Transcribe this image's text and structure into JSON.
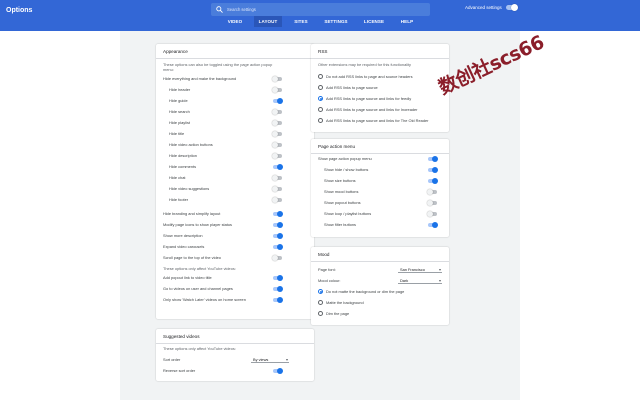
{
  "app": {
    "title": "Options"
  },
  "search": {
    "placeholder": "Search settings"
  },
  "advanced": {
    "label": "Advanced settings",
    "enabled": true
  },
  "tabs": [
    {
      "label": "VIDEO",
      "active": false
    },
    {
      "label": "LAYOUT",
      "active": true
    },
    {
      "label": "SITES",
      "active": false
    },
    {
      "label": "SETTINGS",
      "active": false
    },
    {
      "label": "LICENSE",
      "active": false
    },
    {
      "label": "HELP",
      "active": false
    }
  ],
  "appearance": {
    "title": "Appearance",
    "note": "These options can also be toggled using the page action popup menu:",
    "hide_everything": {
      "label": "Hide everything and make the background",
      "on": false
    },
    "sub_items": [
      {
        "label": "Hide header",
        "on": false
      },
      {
        "label": "Hide guide",
        "on": true
      },
      {
        "label": "Hide search",
        "on": false
      },
      {
        "label": "Hide playlist",
        "on": false
      },
      {
        "label": "Hide title",
        "on": false
      },
      {
        "label": "Hide video action buttons",
        "on": false
      },
      {
        "label": "Hide description",
        "on": false
      },
      {
        "label": "Hide comments",
        "on": true
      },
      {
        "label": "Hide chat",
        "on": false
      },
      {
        "label": "Hide video suggestions",
        "on": false
      },
      {
        "label": "Hide footer",
        "on": false
      }
    ],
    "items": [
      {
        "label": "Hide branding and simplify layout",
        "on": true
      },
      {
        "label": "Modify page icons to show player status",
        "on": true
      },
      {
        "label": "Show more description",
        "on": true
      },
      {
        "label": "Expand video carousels",
        "on": true
      },
      {
        "label": "Scroll page to the top of the video",
        "on": false
      }
    ],
    "note2": "These options only affect YouTube videos:",
    "items2": [
      {
        "label": "Add popout link to video title",
        "on": true
      },
      {
        "label": "Go to videos on user and channel pages",
        "on": true
      },
      {
        "label": "Only show 'Watch Later' videos on home screen",
        "on": true
      }
    ]
  },
  "suggested": {
    "title": "Suggested videos",
    "note": "These options only affect YouTube videos:",
    "sort": {
      "label": "Sort order",
      "value": "By views"
    },
    "reverse": {
      "label": "Reverse sort order",
      "on": true
    }
  },
  "rss": {
    "title": "RSS",
    "note": "Other extensions may be required for this functionality",
    "options": [
      {
        "label": "Do not add RSS links to page and source headers",
        "selected": false
      },
      {
        "label": "Add RSS links to page source",
        "selected": false
      },
      {
        "label": "Add RSS links to page source and links for feedly",
        "selected": true
      },
      {
        "label": "Add RSS links to page source and links for Inoreader",
        "selected": false
      },
      {
        "label": "Add RSS links to page source and links for The Old Reader",
        "selected": false
      }
    ]
  },
  "page_action": {
    "title": "Page action menu",
    "main": {
      "label": "Show page action popup menu",
      "on": true
    },
    "items": [
      {
        "label": "Show hide / show buttons",
        "on": true
      },
      {
        "label": "Show size buttons",
        "on": true
      },
      {
        "label": "Show mood buttons",
        "on": false
      },
      {
        "label": "Show popout buttons",
        "on": false
      },
      {
        "label": "Show loop / playlist buttons",
        "on": false
      },
      {
        "label": "Show filter buttons",
        "on": true
      }
    ]
  },
  "mood": {
    "title": "Mood",
    "font": {
      "label": "Page font:",
      "value": "San Francisco"
    },
    "colour": {
      "label": "Mood colour:",
      "value": "Dark"
    },
    "options": [
      {
        "label": "Do not matte the background or dim the page",
        "selected": true
      },
      {
        "label": "Matte the background",
        "selected": false
      },
      {
        "label": "Dim the page",
        "selected": false
      }
    ]
  },
  "watermark": {
    "text": "数创社scs66"
  },
  "colors": {
    "header": "#3367d6",
    "accent": "#1a73e8",
    "watermark": "#8b1e2a"
  }
}
